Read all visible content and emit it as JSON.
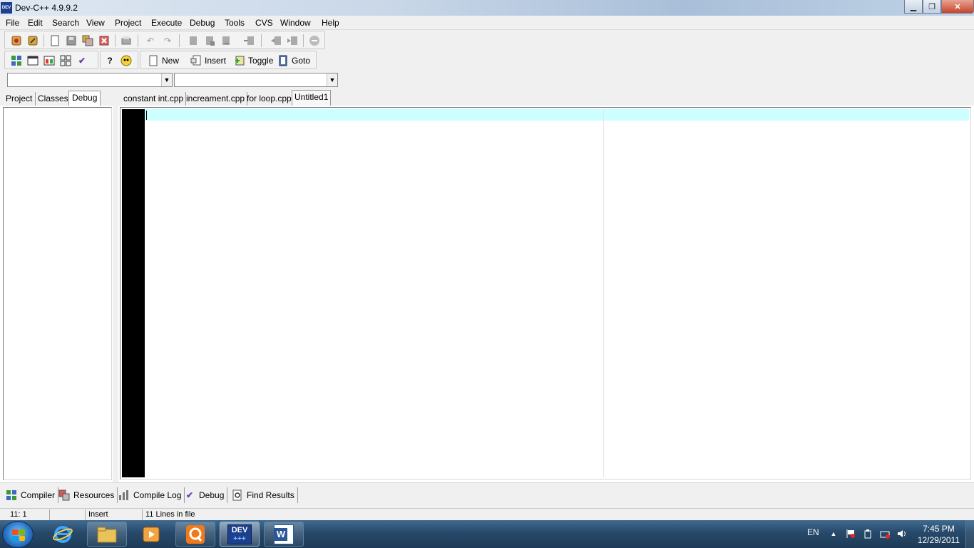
{
  "window": {
    "app_icon_text": "DEV",
    "title": "Dev-C++ 4.9.9.2",
    "minimize_glyph": "▁",
    "maximize_glyph": "❐",
    "close_glyph": "✕"
  },
  "menu": [
    "File",
    "Edit",
    "Search",
    "View",
    "Project",
    "Execute",
    "Debug",
    "Tools",
    "CVS",
    "Window",
    "Help"
  ],
  "toolbar": {
    "new_label": "New",
    "insert_label": "Insert",
    "toggle_label": "Toggle",
    "goto_label": "Goto"
  },
  "combos": {
    "class_value": "",
    "member_value": "",
    "arrow": "▼"
  },
  "left_tabs": [
    "Project",
    "Classes",
    "Debug"
  ],
  "left_active_tab": "Debug",
  "editor_tabs": [
    "constant int.cpp",
    "increament.cpp",
    "for loop.cpp",
    "Untitled1"
  ],
  "editor_active_tab": "Untitled1",
  "bottom_tabs": [
    "Compiler",
    "Resources",
    "Compile Log",
    "Debug",
    "Find Results"
  ],
  "status": {
    "position": "11: 1",
    "modified": "",
    "mode": "Insert",
    "info": "11 Lines in file"
  },
  "taskbar": {
    "dev_label": "DEV",
    "word_label": "W",
    "language": "EN",
    "time": "7:45 PM",
    "date": "12/29/2011"
  },
  "colors": {
    "current_line": "#ccffff",
    "gutter": "#000000",
    "taskbar": "#27496a"
  }
}
